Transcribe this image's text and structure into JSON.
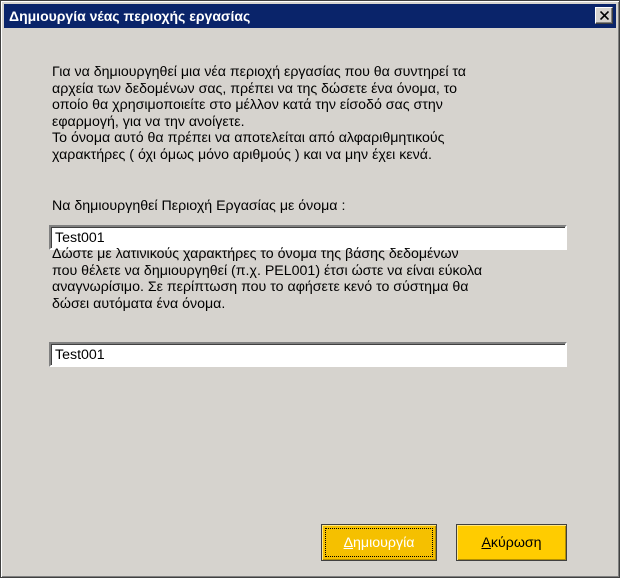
{
  "window": {
    "title": "Δημιουργία νέας περιοχής εργασίας"
  },
  "instructions": {
    "paragraph1": "Για να δημιουργηθεί μια νέα περιοχή εργασίας που θα συντηρεί τα\nαρχεία των δεδομένων σας, πρέπει να της δώσετε ένα όνομα, το\nοποίο θα χρησιμοποιείτε στο μέλλον κατά την είσοδό σας στην\nεφαρμογή, για να την ανοίγετε.\nΤο όνομα αυτό θα πρέπει να αποτελείται από αλφαριθμητικούς\nχαρακτήρες ( όχι όμως μόνο αριθμούς ) και να μην έχει κενά.",
    "name_label": "Να δημιουργηθεί Περιοχή Εργασίας με όνομα :",
    "paragraph2": "Δώστε με λατινικούς χαρακτήρες το όνομα της βάσης δεδομένων\nπου θέλετε να δημιουργηθεί (π.χ. PEL001) έτσι ώστε να είναι εύκολα\nαναγνωρίσιμο. Σε περίπτωση που το αφήσετε κενό  το σύστημα θα\nδώσει αυτόματα ένα όνομα."
  },
  "fields": {
    "workspace_name": "Test001",
    "database_name": "Test001"
  },
  "buttons": {
    "create_mnemonic": "Δ",
    "create_rest": "ημιουργία",
    "cancel_mnemonic": "Α",
    "cancel_rest": "κύρωση"
  },
  "colors": {
    "titlebar": "#0A246A",
    "dialog_bg": "#D6D3CE",
    "button_bg": "#FFCC00"
  },
  "icons": {
    "close": "close-icon"
  }
}
